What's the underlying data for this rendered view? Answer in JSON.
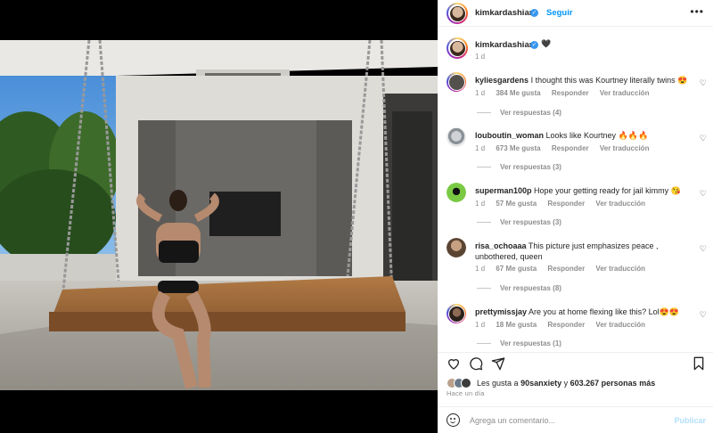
{
  "post": {
    "username": "kimkardashian",
    "follow_label": "Seguir",
    "more_icon": "ellipsis-icon",
    "verified_icon": "verified-badge-icon"
  },
  "caption": {
    "username": "kimkardashian",
    "emoji": "🖤",
    "time": "1 d"
  },
  "comments": [
    {
      "user": "kyliesgardens",
      "text": "I thought this was Kourtney literally twins 😍",
      "time": "1 d",
      "likes": "384 Me gusta",
      "reply": "Responder",
      "translate": "Ver traducción",
      "replies": "Ver respuestas (4)"
    },
    {
      "user": "louboutin_woman",
      "text": "Looks like Kourtney 🔥🔥🔥",
      "time": "1 d",
      "likes": "673 Me gusta",
      "reply": "Responder",
      "translate": "Ver traducción",
      "replies": "Ver respuestas (3)"
    },
    {
      "user": "superman100p",
      "text": "Hope your getting ready for jail kimmy 😘",
      "time": "1 d",
      "likes": "57 Me gusta",
      "reply": "Responder",
      "translate": "Ver traducción",
      "replies": "Ver respuestas (3)"
    },
    {
      "user": "risa_ochoaaa",
      "text": "This picture just emphasizes peace , unbothered, queen",
      "time": "1 d",
      "likes": "67 Me gusta",
      "reply": "Responder",
      "translate": "Ver traducción",
      "replies": "Ver respuestas (8)"
    },
    {
      "user": "prettymissjay",
      "text": "Are you at home flexing like this? Lol😍😍",
      "time": "1 d",
      "likes": "18 Me gusta",
      "reply": "Responder",
      "translate": "Ver traducción",
      "replies": "Ver respuestas (1)"
    }
  ],
  "likes": {
    "prefix": "Les gusta a",
    "first_user": "90sanxiety",
    "and": "y",
    "others": "603.267 personas más"
  },
  "posted_ago": "Hace un día",
  "composer": {
    "placeholder": "Agrega un comentario...",
    "publish_label": "Publicar"
  },
  "colors": {
    "accent": "#0095f6",
    "verified": "#3897f0",
    "muted": "#8e8e8e",
    "publish_disabled": "#b2dffc"
  }
}
